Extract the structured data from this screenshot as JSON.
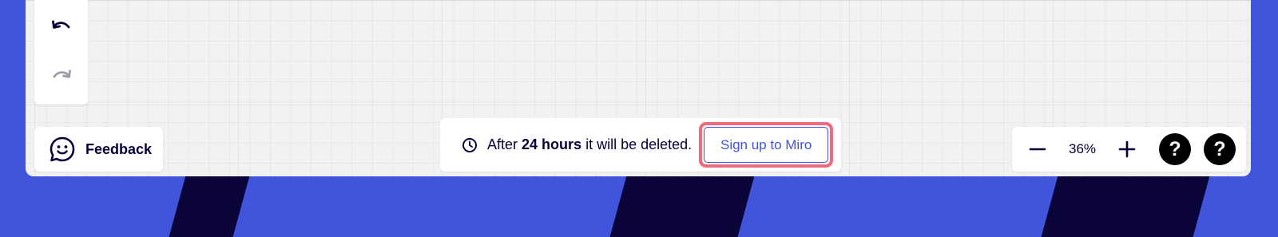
{
  "colors": {
    "background": "#4154dc",
    "stripe": "#0a0438",
    "canvas": "#f2f2f2",
    "accent": "#4154dc",
    "highlight_outline": "#ef6a7e",
    "text": "#050038"
  },
  "toolbar": {
    "undo_icon": "undo-icon",
    "redo_icon": "redo-icon"
  },
  "feedback": {
    "icon": "smiley-chat-icon",
    "label": "Feedback"
  },
  "notice": {
    "icon": "clock-icon",
    "prefix": "After",
    "bold": "24 hours",
    "suffix": "it will be deleted.",
    "signup_label": "Sign up to Miro"
  },
  "zoom": {
    "out_icon": "minus-icon",
    "level": "36%",
    "in_icon": "plus-icon"
  },
  "help": {
    "label_1": "?",
    "label_2": "?"
  }
}
